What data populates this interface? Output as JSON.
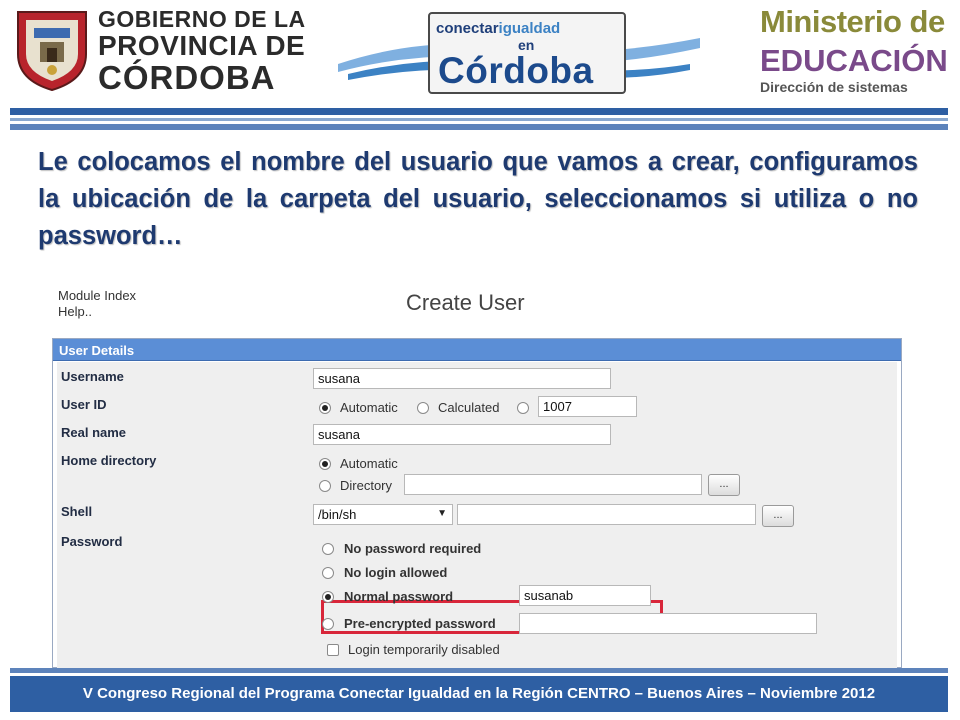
{
  "header": {
    "gov_logo": {
      "line1": "GOBIERNO DE LA",
      "line2": "PROVINCIA DE",
      "line3": "CÓRDOBA"
    },
    "program_logo": {
      "line1_a": "conectar",
      "line1_b": "igualdad",
      "line2": "en",
      "line3": "Córdoba"
    },
    "ministry_logo": {
      "line1": "Ministerio de",
      "line2": "EDUCACIÓN",
      "line3": "Dirección de sistemas"
    }
  },
  "description": "Le colocamos el nombre del usuario que vamos a crear, configuramos la ubicación de la carpeta del usuario, seleccionamos si utiliza o no password…",
  "module": {
    "links": [
      "Module Index",
      "Help.."
    ],
    "title": "Create User",
    "section_title": "User Details",
    "fields": {
      "username": {
        "label": "Username",
        "value": "susana"
      },
      "user_id": {
        "label": "User ID",
        "opt_automatic": "Automatic",
        "opt_calculated": "Calculated",
        "value": "1007"
      },
      "real_name": {
        "label": "Real name",
        "value": "susana"
      },
      "home_directory": {
        "label": "Home directory",
        "opt_automatic": "Automatic",
        "opt_directory": "Directory",
        "browse": "..."
      },
      "shell": {
        "label": "Shell",
        "value": "/bin/sh",
        "browse": "..."
      },
      "password": {
        "label": "Password",
        "opt_none": "No password required",
        "opt_nologin": "No login allowed",
        "opt_normal": "Normal password",
        "normal_value": "susanab",
        "opt_preencrypted": "Pre-encrypted password",
        "disabled_label": "Login temporarily disabled"
      }
    }
  },
  "footer": "V Congreso Regional del Programa Conectar Igualdad en la Región CENTRO – Buenos Aires – Noviembre 2012",
  "colors": {
    "brand_blue": "#2e5fa3",
    "panel_header": "#5b8ed6",
    "highlight_red": "#d8263a",
    "text_blue": "#1e3a70"
  }
}
